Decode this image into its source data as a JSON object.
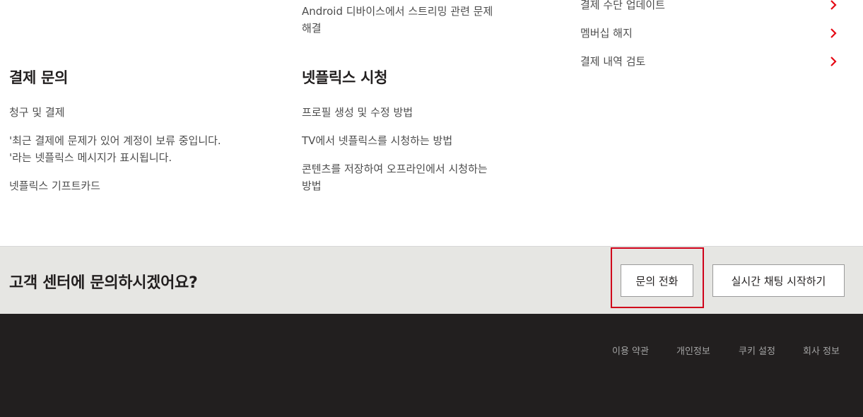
{
  "columns": {
    "left": {
      "heading": "결제 문의",
      "links": [
        "청구 및 결제",
        "'최근 결제에 문제가 있어 계정이 보류 중입니다.\n'라는 넷플릭스 메시지가 표시됩니다.",
        "넷플릭스 기프트카드"
      ]
    },
    "middle": {
      "prev_link": "Android 디바이스에서 스트리밍 관련 문제\n해결",
      "heading": "넷플릭스 시청",
      "links": [
        "프로필 생성 및 수정 방법",
        "TV에서 넷플릭스를 시청하는 방법",
        "콘텐츠를 저장하여 오프라인에서 시청하는\n방법"
      ]
    },
    "right": {
      "items": [
        {
          "label": "결제 수단 업데이트",
          "icon": "chevron-right-icon"
        },
        {
          "label": "멤버십 해지",
          "icon": "chevron-right-icon"
        },
        {
          "label": "결제 내역 검토",
          "icon": "chevron-right-icon"
        }
      ]
    }
  },
  "help_bar": {
    "question": "고객 센터에 문의하시겠어요?",
    "call_button": "문의 전화",
    "chat_button": "실시간 채팅 시작하기"
  },
  "footer": {
    "links": [
      "이용 약관",
      "개인정보",
      "쿠키 설정",
      "회사 정보"
    ]
  },
  "colors": {
    "accent": "#e50914",
    "highlight": "#d0021b",
    "help_bar_bg": "#e6e6e3",
    "footer_bg": "#221f1f"
  }
}
